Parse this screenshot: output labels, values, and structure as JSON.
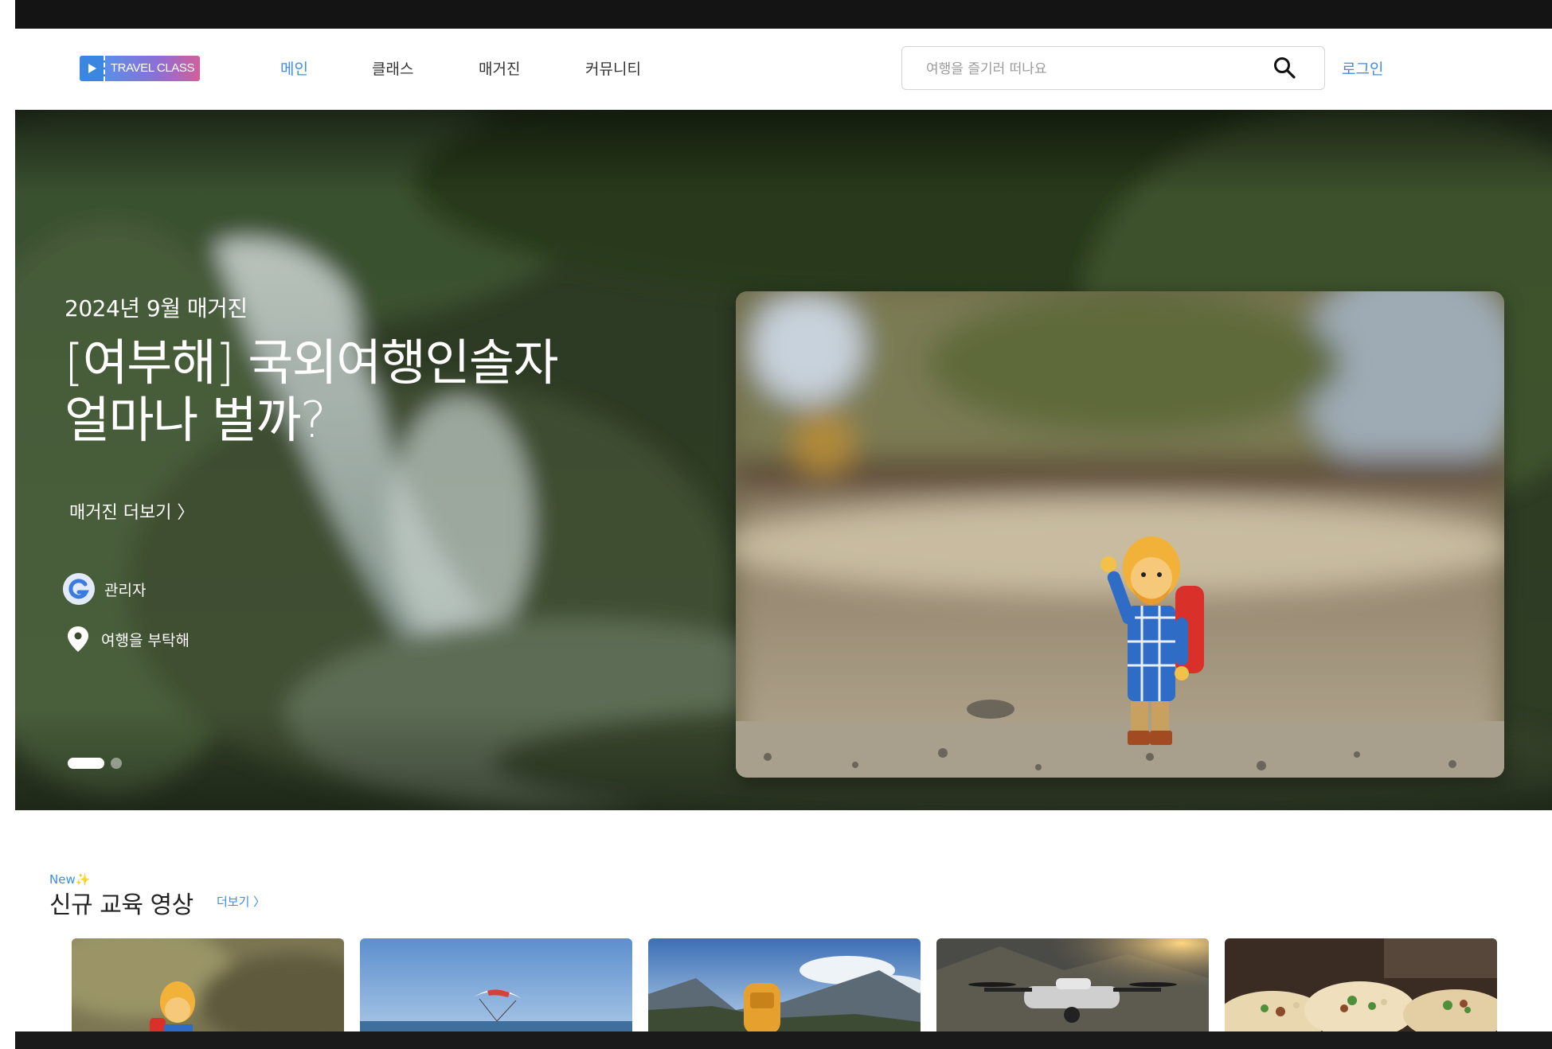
{
  "brand": {
    "logo_text": "TRAVEL CLASS",
    "accent": "#3d8ee6"
  },
  "nav": {
    "items": [
      "메인",
      "클래스",
      "매거진",
      "커뮤니티"
    ],
    "active_index": 0
  },
  "search": {
    "placeholder": "여행을 즐기러 떠나요",
    "value": ""
  },
  "header": {
    "login": "로그인"
  },
  "hero": {
    "meta": "2024년 9월 매거진",
    "title_line1": "[여부해] 국외여행인솔자",
    "title_line2": "얼마나 벌까?",
    "more": "매거진 더보기  〉",
    "author": "관리자",
    "location": "여행을 부탁해",
    "slide_count": 2,
    "active_slide": 1
  },
  "section": {
    "badge": "New✨",
    "title": "신규 교육 영상",
    "more": "더보기  〉",
    "cards": [
      "toy-traveler",
      "paraglider",
      "backpacker-mountain",
      "drone",
      "tacos"
    ]
  }
}
